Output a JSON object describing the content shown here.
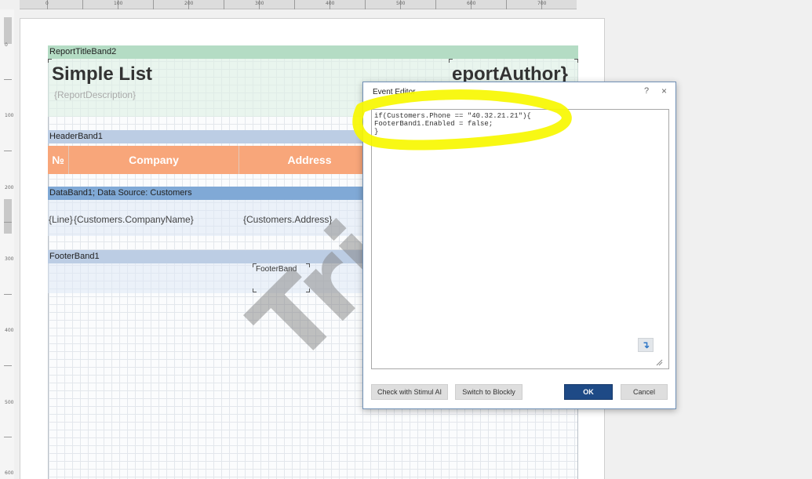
{
  "ruler": {
    "top_labels": [
      "0",
      "100",
      "200",
      "300",
      "400",
      "500",
      "600",
      "700"
    ],
    "left_labels": [
      "0",
      "100",
      "200",
      "300",
      "400",
      "500",
      "600"
    ]
  },
  "report": {
    "title_band": "ReportTitleBand2",
    "title": "Simple List",
    "author": "eportAuthor}",
    "description": "{ReportDescription}",
    "header_band": "HeaderBand1",
    "headers": [
      "№",
      "Company",
      "Address"
    ],
    "data_band": "DataBand1; Data Source: Customers",
    "data_fields": [
      "{Line}",
      "{Customers.CompanyName}",
      "{Customers.Address}"
    ],
    "footer_band": "FooterBand1",
    "footer_text": "FooterBand",
    "watermark": "Trial"
  },
  "dialog": {
    "title": "Event Editor",
    "help": "?",
    "close": "×",
    "code": "if(Customers.Phone == \"40.32.21.21\"){\nFooterBand1.Enabled = false;\n}",
    "buttons": {
      "check": "Check with Stimul AI",
      "blockly": "Switch to Blockly",
      "ok": "OK",
      "cancel": "Cancel"
    }
  },
  "colors": {
    "highlighter": "#f7f700",
    "ok_button": "#1e4a86",
    "header_cell": "#f8a67a"
  }
}
